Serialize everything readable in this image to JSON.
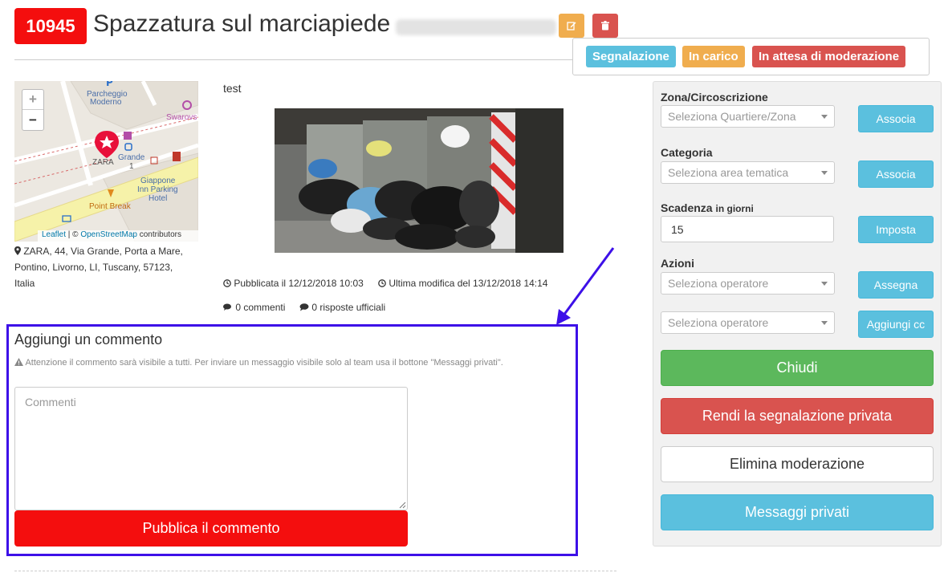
{
  "header": {
    "id": "10945",
    "title": "Spazzatura sul marciapiede"
  },
  "status_tags": [
    "Segnalazione",
    "In carico",
    "In attesa di moderazione"
  ],
  "colors": {
    "brand_red": "#f40e0e",
    "warning": "#f0ad4e",
    "danger": "#d9534f",
    "info": "#5bc0de",
    "success": "#5cb85c",
    "highlight": "#3d10e8"
  },
  "map": {
    "zoom_in": "+",
    "zoom_out": "−",
    "labels": {
      "parcheggio": "Parcheggio",
      "moderno": "Moderno",
      "swarovski": "Swarovs",
      "zara": "ZARA",
      "grande": "Grande",
      "grande_num": "1",
      "giappone": "Giappone",
      "inn_parking": "Inn Parking",
      "hotel": "Hotel",
      "point_break": "Point Break"
    },
    "attribution": {
      "leaflet": "Leaflet",
      "sep": " | © ",
      "osm": "OpenStreetMap",
      "contributors": " contributors"
    }
  },
  "address": "ZARA, 44, Via Grande, Porta a Mare, Pontino, Livorno, LI, Tuscany, 57123, Italia",
  "description": "test",
  "meta": {
    "published": "Pubblicata il 12/12/2018 10:03",
    "modified": "Ultima modifica del 13/12/2018 14:14",
    "comments": "0 commenti",
    "official_replies": "0 risposte ufficiali"
  },
  "comment_form": {
    "title": "Aggiungi un commento",
    "warning": "Attenzione il commento sarà visibile a tutti. Per inviare un messaggio visibile solo al team usa il bottone \"Messaggi privati\".",
    "placeholder": "Commenti",
    "submit_label": "Pubblica il commento"
  },
  "sidebar": {
    "zona_label": "Zona/Circoscrizione",
    "zona_placeholder": "Seleziona Quartiere/Zona",
    "zona_button": "Associa",
    "categoria_label": "Categoria",
    "categoria_placeholder": "Seleziona area tematica",
    "categoria_button": "Associa",
    "scadenza_label": "Scadenza",
    "scadenza_sub": "in giorni",
    "scadenza_value": "15",
    "scadenza_button": "Imposta",
    "azioni_label": "Azioni",
    "operatore_placeholder_1": "Seleziona operatore",
    "assegna_button": "Assegna",
    "operatore_placeholder_2": "Seleziona operatore",
    "aggiungi_cc_button": "Aggiungi cc",
    "chiudi_button": "Chiudi",
    "privata_button": "Rendi la segnalazione privata",
    "elimina_button": "Elimina moderazione",
    "messaggi_button": "Messaggi privati"
  }
}
